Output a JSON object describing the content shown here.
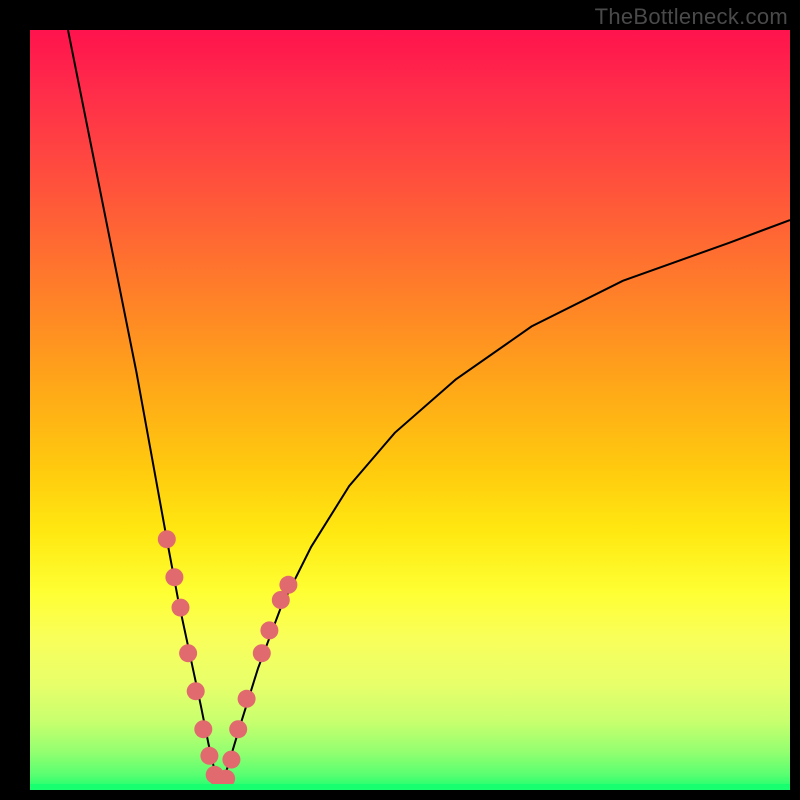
{
  "watermark": "TheBottleneck.com",
  "colors": {
    "background": "#000000",
    "curve": "#000000",
    "marker": "#e06a6e",
    "gradient_top": "#ff134d",
    "gradient_bottom": "#18ff6f"
  },
  "chart_data": {
    "type": "line",
    "title": "",
    "xlabel": "",
    "ylabel": "",
    "xlim": [
      0,
      100
    ],
    "ylim": [
      0,
      100
    ],
    "legend": false,
    "grid": false,
    "axes_visible": false,
    "vertex_x": 25,
    "series": [
      {
        "name": "left-branch",
        "x": [
          5,
          8,
          11,
          14,
          16,
          18,
          19.5,
          21,
          22.5,
          23.5,
          24.3,
          25
        ],
        "y": [
          100,
          85,
          70,
          55,
          44,
          33,
          25,
          18,
          11,
          6,
          2.5,
          0
        ]
      },
      {
        "name": "right-branch",
        "x": [
          25,
          26,
          27.5,
          30,
          33,
          37,
          42,
          48,
          56,
          66,
          78,
          92,
          100
        ],
        "y": [
          0,
          3,
          8,
          16,
          24,
          32,
          40,
          47,
          54,
          61,
          67,
          72,
          75
        ]
      }
    ],
    "scatter_points": {
      "name": "highlighted-range",
      "color": "#e06a6e",
      "points": [
        {
          "x": 18.0,
          "y": 33
        },
        {
          "x": 19.0,
          "y": 28
        },
        {
          "x": 19.8,
          "y": 24
        },
        {
          "x": 20.8,
          "y": 18
        },
        {
          "x": 21.8,
          "y": 13
        },
        {
          "x": 22.8,
          "y": 8
        },
        {
          "x": 23.6,
          "y": 4.5
        },
        {
          "x": 24.3,
          "y": 2
        },
        {
          "x": 25.0,
          "y": 0.5
        },
        {
          "x": 25.8,
          "y": 1.5
        },
        {
          "x": 26.5,
          "y": 4
        },
        {
          "x": 27.4,
          "y": 8
        },
        {
          "x": 28.5,
          "y": 12
        },
        {
          "x": 30.5,
          "y": 18
        },
        {
          "x": 31.5,
          "y": 21
        },
        {
          "x": 33.0,
          "y": 25
        },
        {
          "x": 34.0,
          "y": 27
        }
      ]
    }
  }
}
